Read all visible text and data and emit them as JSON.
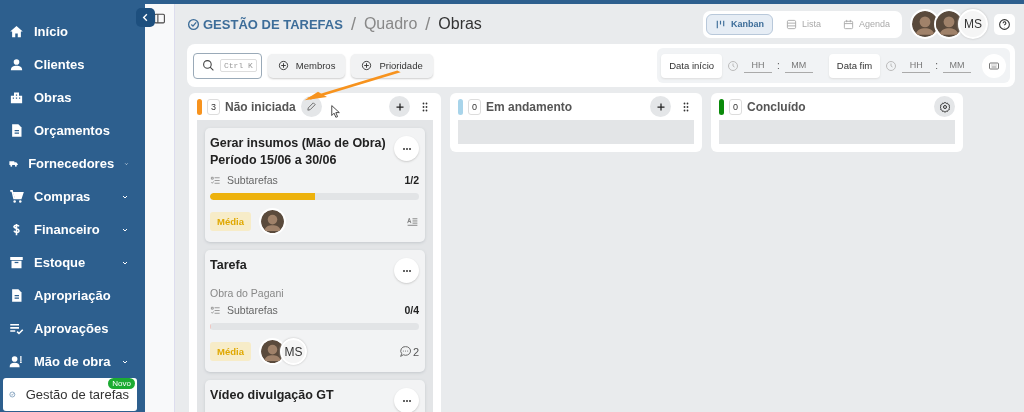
{
  "sidebar": {
    "items": [
      {
        "label": "Início",
        "expandable": false,
        "selected": false
      },
      {
        "label": "Clientes",
        "expandable": false,
        "selected": false
      },
      {
        "label": "Obras",
        "expandable": false,
        "selected": false
      },
      {
        "label": "Orçamentos",
        "expandable": false,
        "selected": false
      },
      {
        "label": "Fornecedores",
        "expandable": true,
        "selected": false
      },
      {
        "label": "Compras",
        "expandable": true,
        "selected": false
      },
      {
        "label": "Financeiro",
        "expandable": true,
        "selected": false
      },
      {
        "label": "Estoque",
        "expandable": true,
        "selected": false
      },
      {
        "label": "Apropriação",
        "expandable": false,
        "selected": false
      },
      {
        "label": "Aprovações",
        "expandable": false,
        "selected": false
      },
      {
        "label": "Mão de obra",
        "expandable": true,
        "selected": false
      },
      {
        "label": "Gestão de tarefas",
        "expandable": false,
        "selected": true,
        "badge": "Novo"
      }
    ]
  },
  "header": {
    "breadcrumb": [
      {
        "label": "GESTÃO DE TAREFAS",
        "kind": "module"
      },
      {
        "label": "Quadro",
        "kind": "link"
      },
      {
        "label": "Obras",
        "kind": "current"
      }
    ],
    "separators": [
      "/",
      "/"
    ],
    "views": [
      {
        "label": "Kanban",
        "selected": true
      },
      {
        "label": "Lista",
        "selected": false
      },
      {
        "label": "Agenda",
        "selected": false
      }
    ],
    "avatars": [
      {
        "kind": "photo"
      },
      {
        "kind": "photo"
      },
      {
        "kind": "initials",
        "label": "MS"
      }
    ]
  },
  "toolbar": {
    "search": {
      "shortcut": "Ctrl K"
    },
    "filters": [
      "Membros",
      "Prioridade"
    ],
    "date_filters": [
      {
        "label": "Data início",
        "hour_placeholder": "HH",
        "separator": ":",
        "minute_placeholder": "MM"
      },
      {
        "label": "Data fim",
        "hour_placeholder": "HH",
        "separator": ":",
        "minute_placeholder": "MM"
      }
    ]
  },
  "columns": [
    {
      "title": "Não iniciada",
      "count": "3",
      "color": "#f7931e",
      "editable": true,
      "addable": true,
      "draggable": true,
      "configurable": false,
      "cards": [
        {
          "title": "Gerar insumos (Mão de Obra) Período 15/06 a 30/06",
          "subtasks": {
            "label": "Subtarefas",
            "count": "1/2",
            "level": 0.5
          },
          "priority": "Média",
          "assignees": [
            {
              "kind": "photo"
            }
          ],
          "indicators": [
            {
              "kind": "description"
            }
          ]
        },
        {
          "title": "Tarefa",
          "subtitle": "Obra do Pagani",
          "subtasks": {
            "label": "Subtarefas",
            "count": "0/4",
            "level": 0
          },
          "priority": "Média",
          "assignees": [
            {
              "kind": "photo"
            },
            {
              "kind": "initials",
              "label": "MS"
            }
          ],
          "indicators": [
            {
              "kind": "comments",
              "count": "2"
            }
          ]
        },
        {
          "title": "Vídeo divulgação GT"
        }
      ]
    },
    {
      "title": "Em andamento",
      "count": "0",
      "color": "#a8d4ea",
      "editable": false,
      "addable": true,
      "draggable": true,
      "configurable": false
    },
    {
      "title": "Concluído",
      "count": "0",
      "color": "#0a8a0a",
      "editable": false,
      "addable": false,
      "draggable": false,
      "configurable": true
    }
  ]
}
